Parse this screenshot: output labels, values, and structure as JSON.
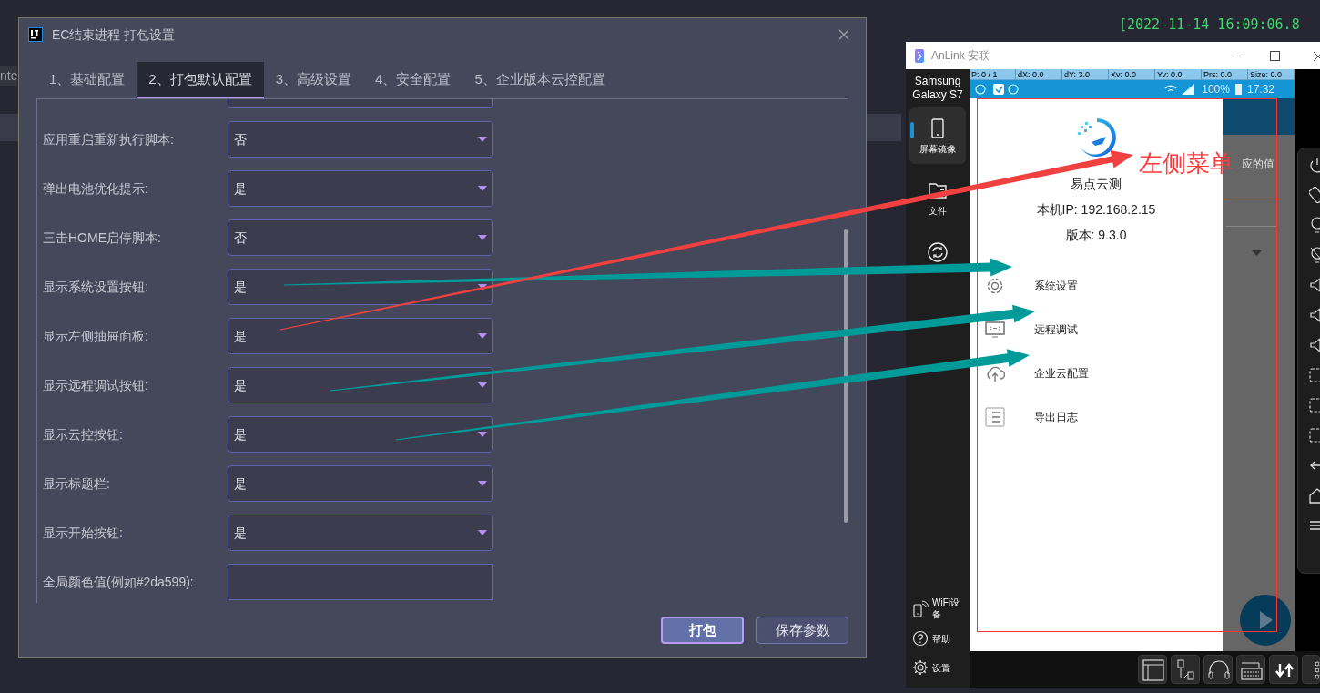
{
  "background": {
    "log_line": "[2022-11-14 16:09:06.8",
    "editor_fragment": "nte"
  },
  "dialog": {
    "title": "EC结束进程 打包设置",
    "tabs": [
      {
        "label": "1、基础配置",
        "selected": false
      },
      {
        "label": "2、打包默认配置",
        "selected": true
      },
      {
        "label": "3、高级设置",
        "selected": false
      },
      {
        "label": "4、安全配置",
        "selected": false
      },
      {
        "label": "5、企业版本云控配置",
        "selected": false
      }
    ],
    "rows": [
      {
        "kind": "select",
        "label": "应用重启重新执行脚本:",
        "value": "否"
      },
      {
        "kind": "select",
        "label": "弹出电池优化提示:",
        "value": "是"
      },
      {
        "kind": "select",
        "label": "三击HOME启停脚本:",
        "value": "否"
      },
      {
        "kind": "select",
        "label": "显示系统设置按钮:",
        "value": "是"
      },
      {
        "kind": "select",
        "label": "显示左侧抽屉面板:",
        "value": "是"
      },
      {
        "kind": "select",
        "label": "显示远程调试按钮:",
        "value": "是"
      },
      {
        "kind": "select",
        "label": "显示云控按钮:",
        "value": "是"
      },
      {
        "kind": "select",
        "label": "显示标题栏:",
        "value": "是"
      },
      {
        "kind": "select",
        "label": "显示开始按钮:",
        "value": "是"
      },
      {
        "kind": "text",
        "label": "全局颜色值(例如#2da599):"
      }
    ],
    "buttons": [
      {
        "label": "打包",
        "primary": true
      },
      {
        "label": "保存参数",
        "primary": false
      }
    ]
  },
  "anlink": {
    "title": "AnLink 安联",
    "device": "Samsung Galaxy S7",
    "nav": [
      {
        "label": "屏幕镜像",
        "selected": true
      },
      {
        "label": "文件",
        "selected": false
      },
      {
        "selected": false
      }
    ],
    "bottom_nav": [
      "WiFi设备",
      "帮助",
      "设置"
    ],
    "phone": {
      "pointer_stats": [
        "P: 0 / 1",
        "dX: 0.0",
        "dY: 3.0",
        "Xv: 0.0",
        "Yv: 0.0",
        "Prs: 0.0",
        "Size: 0.0"
      ],
      "battery": "100%",
      "time": "17:32",
      "app_name": "易点云测",
      "ip": "本机IP: 192.168.2.15",
      "version": "版本: 9.3.0",
      "menu": [
        "系统设置",
        "远程调试",
        "企业云配置",
        "导出日志"
      ],
      "background_text": "应的值"
    }
  },
  "annotation": {
    "label": "左侧菜单"
  }
}
